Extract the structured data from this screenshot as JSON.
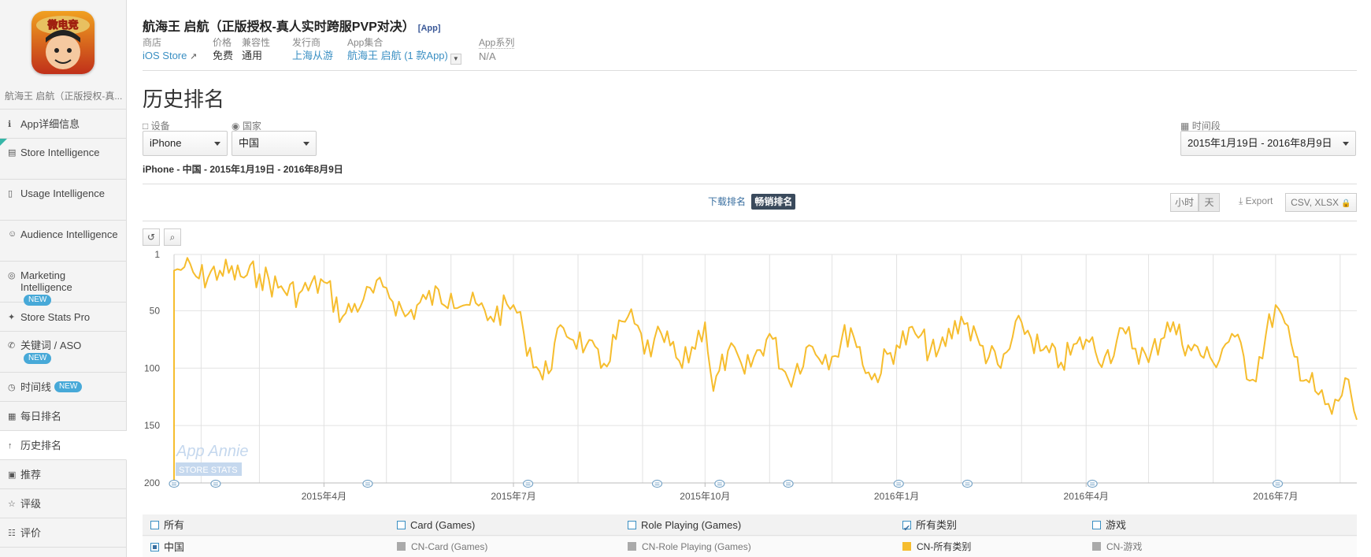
{
  "sidebar": {
    "app_name": "航海王 启航（正版授权-真...",
    "icon_text": "微电竞",
    "items": [
      {
        "icon": "info-icon",
        "glyph": "ℹ",
        "label": "App详细信息",
        "badge": ""
      },
      {
        "icon": "store-icon",
        "glyph": "▤",
        "label": "Store Intelligence",
        "badge": ""
      },
      {
        "icon": "mobile-icon",
        "glyph": "▯",
        "label": "Usage Intelligence",
        "badge": ""
      },
      {
        "icon": "person-icon",
        "glyph": "☺",
        "label": "Audience Intelligence",
        "badge": ""
      },
      {
        "icon": "target-icon",
        "glyph": "◎",
        "label": "Marketing Intelligence",
        "badge": "NEW"
      },
      {
        "icon": "stats-icon",
        "glyph": "✦",
        "label": "Store Stats Pro",
        "badge": ""
      },
      {
        "icon": "key-icon",
        "glyph": "✆",
        "label": "关键词 / ASO",
        "badge": "NEW"
      },
      {
        "icon": "clock-icon",
        "glyph": "◷",
        "label": "时间线",
        "badge": "NEW"
      },
      {
        "icon": "calendar-icon",
        "glyph": "▦",
        "label": "每日排名",
        "badge": ""
      },
      {
        "icon": "arrow-up-icon",
        "glyph": "↑",
        "label": "历史排名",
        "badge": ""
      },
      {
        "icon": "featured-icon",
        "glyph": "▣",
        "label": "推荐",
        "badge": ""
      },
      {
        "icon": "star-icon",
        "glyph": "☆",
        "label": "评级",
        "badge": ""
      },
      {
        "icon": "comment-icon",
        "glyph": "☷",
        "label": "评价",
        "badge": ""
      }
    ]
  },
  "header": {
    "title": "航海王 启航（正版授权-真人实时跨服PVP对决）",
    "tag": "[App]",
    "meta": {
      "store_k": "商店",
      "store_v": "iOS Store",
      "price_k": "价格",
      "price_v": "免费",
      "compat_k": "兼容性",
      "compat_v": "通用",
      "publisher_k": "发行商",
      "publisher_v": "上海从游",
      "collection_k": "App集合",
      "collection_v": "航海王 启航 (1 款App)",
      "series_k": "App系列",
      "series_v": "N/A"
    }
  },
  "page": {
    "title": "历史排名",
    "device_label": "设备",
    "device_value": "iPhone",
    "country_label": "国家",
    "country_value": "中国",
    "period_label": "时间段",
    "period_value": "2015年1月19日 - 2016年8月9日",
    "subtitle": "iPhone - 中国 - 2015年1月19日 - 2016年8月9日",
    "tab_download": "下载排名",
    "tab_grossing": "畅销排名",
    "btn_hour": "小时",
    "btn_day": "天",
    "export_label": "Export",
    "export_formats": "CSV, XLSX"
  },
  "watermark": {
    "line1": "App Annie",
    "line2": "STORE STATS"
  },
  "chart_data": {
    "type": "line",
    "title": "",
    "y_reversed": true,
    "ylim": [
      1,
      200
    ],
    "yticks": [
      "1",
      "50",
      "100",
      "150",
      "200"
    ],
    "xticks": [
      "2015年4月",
      "2015年7月",
      "2015年10月",
      "2016年1月",
      "2016年4月",
      "2016年7月"
    ],
    "x_range": [
      "2015-01-19",
      "2016-08-09"
    ],
    "series": [
      {
        "name": "CN-所有类别",
        "color": "#f6bd2e",
        "x": [
          "2015-01-19",
          "2015-01-24",
          "2015-01-31",
          "2015-02-10",
          "2015-02-20",
          "2015-03-01",
          "2015-03-10",
          "2015-03-20",
          "2015-04-01",
          "2015-04-10",
          "2015-04-20",
          "2015-05-01",
          "2015-05-10",
          "2015-05-20",
          "2015-06-01",
          "2015-06-10",
          "2015-06-20",
          "2015-07-01",
          "2015-07-06",
          "2015-07-15",
          "2015-07-25",
          "2015-08-05",
          "2015-08-12",
          "2015-08-25",
          "2015-09-05",
          "2015-09-10",
          "2015-09-20",
          "2015-10-01",
          "2015-10-05",
          "2015-10-12",
          "2015-10-20",
          "2015-11-01",
          "2015-11-10",
          "2015-11-20",
          "2015-12-01",
          "2015-12-10",
          "2015-12-20",
          "2016-01-01",
          "2016-01-10",
          "2016-01-20",
          "2016-02-01",
          "2016-02-10",
          "2016-02-20",
          "2016-03-01",
          "2016-03-10",
          "2016-03-20",
          "2016-04-01",
          "2016-04-10",
          "2016-04-20",
          "2016-05-01",
          "2016-05-10",
          "2016-05-20",
          "2016-06-01",
          "2016-06-10",
          "2016-06-20",
          "2016-07-01",
          "2016-07-10",
          "2016-07-20",
          "2016-07-28",
          "2016-08-05",
          "2016-08-09"
        ],
        "y": [
          15,
          12,
          22,
          15,
          20,
          18,
          30,
          35,
          25,
          55,
          40,
          30,
          55,
          40,
          35,
          45,
          55,
          45,
          70,
          110,
          65,
          80,
          100,
          55,
          90,
          70,
          100,
          60,
          120,
          85,
          105,
          70,
          110,
          80,
          90,
          65,
          110,
          80,
          70,
          90,
          55,
          80,
          100,
          60,
          85,
          95,
          75,
          90,
          70,
          95,
          60,
          80,
          95,
          70,
          110,
          45,
          90,
          120,
          140,
          110,
          145
        ]
      }
    ],
    "legend_row1": [
      {
        "label": "所有",
        "checked": false
      },
      {
        "label": "Card (Games)",
        "checked": false
      },
      {
        "label": "Role Playing (Games)",
        "checked": false
      },
      {
        "label": "所有类别",
        "checked": true
      },
      {
        "label": "游戏",
        "checked": false
      }
    ],
    "legend_row2": [
      {
        "label": "中国",
        "color": ""
      },
      {
        "label": "CN-Card (Games)",
        "color": "#aaaaaa"
      },
      {
        "label": "CN-Role Playing (Games)",
        "color": "#aaaaaa"
      },
      {
        "label": "CN-所有类别",
        "color": "#f6bd2e"
      },
      {
        "label": "CN-游戏",
        "color": "#aaaaaa"
      }
    ]
  }
}
